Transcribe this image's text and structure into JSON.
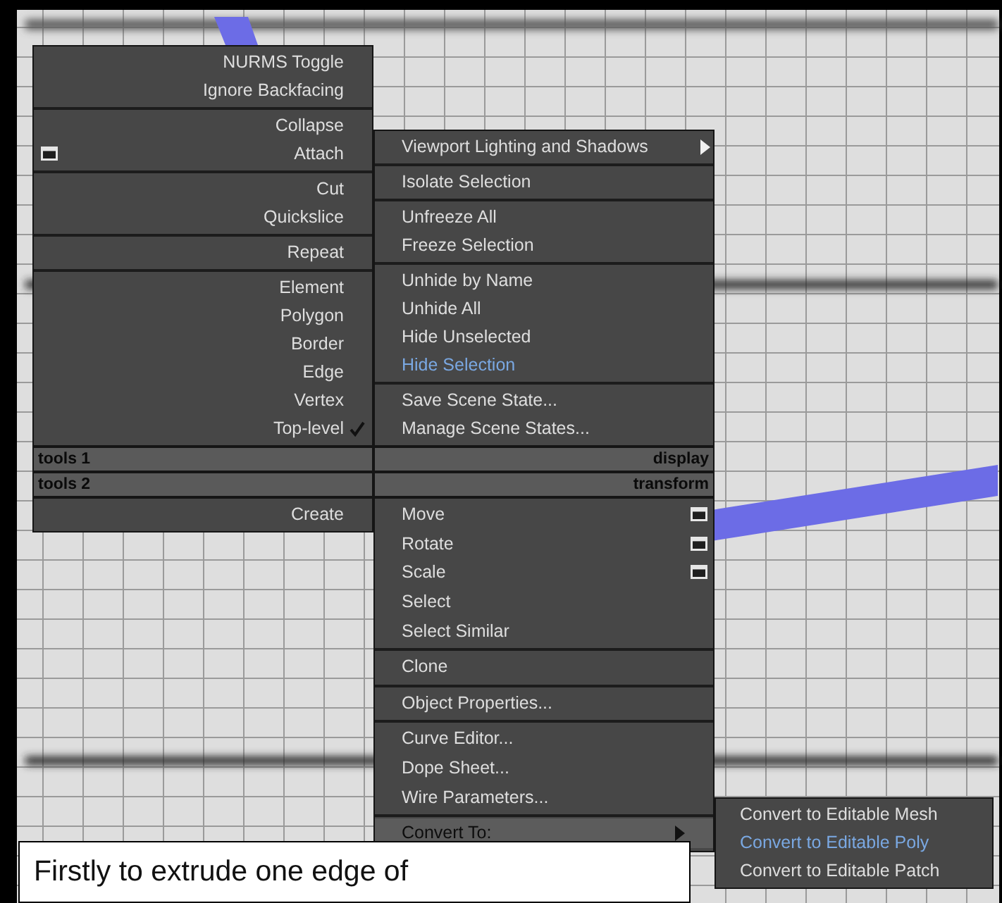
{
  "quad_menu": {
    "quads": [
      {
        "title": "tools 1",
        "groups": [
          {
            "items": [
              {
                "label": "NURMS Toggle",
                "kind": "plain",
                "checked": false,
                "disabled": false,
                "selected": false
              },
              {
                "label": "Ignore Backfacing",
                "kind": "plain",
                "checked": false,
                "disabled": false,
                "selected": false
              }
            ]
          },
          {
            "items": [
              {
                "label": "Collapse",
                "kind": "plain",
                "checked": false,
                "disabled": false,
                "selected": false
              },
              {
                "label": "Attach",
                "kind": "options",
                "checked": false,
                "disabled": false,
                "selected": false
              }
            ]
          },
          {
            "items": [
              {
                "label": "Cut",
                "kind": "plain",
                "checked": false,
                "disabled": false,
                "selected": false
              },
              {
                "label": "Quickslice",
                "kind": "plain",
                "checked": false,
                "disabled": false,
                "selected": false
              }
            ]
          },
          {
            "items": [
              {
                "label": "Repeat",
                "kind": "plain",
                "checked": false,
                "disabled": false,
                "selected": false
              }
            ]
          },
          {
            "items": [
              {
                "label": "Element",
                "kind": "plain",
                "checked": false,
                "disabled": false,
                "selected": false
              },
              {
                "label": "Polygon",
                "kind": "plain",
                "checked": false,
                "disabled": false,
                "selected": false
              },
              {
                "label": "Border",
                "kind": "plain",
                "checked": false,
                "disabled": false,
                "selected": false
              },
              {
                "label": "Edge",
                "kind": "plain",
                "checked": false,
                "disabled": false,
                "selected": false
              },
              {
                "label": "Vertex",
                "kind": "plain",
                "checked": false,
                "disabled": false,
                "selected": false
              },
              {
                "label": "Top-level",
                "kind": "plain",
                "checked": true,
                "disabled": false,
                "selected": false
              }
            ]
          }
        ]
      },
      {
        "title": "display",
        "groups": [
          {
            "items": [
              {
                "label": "Viewport Lighting and Shadows",
                "kind": "submenu",
                "checked": false,
                "disabled": false,
                "selected": false
              }
            ]
          },
          {
            "items": [
              {
                "label": "Isolate Selection",
                "kind": "plain",
                "checked": false,
                "disabled": false,
                "selected": false
              }
            ]
          },
          {
            "items": [
              {
                "label": "Unfreeze All",
                "kind": "plain",
                "checked": false,
                "disabled": false,
                "selected": false
              },
              {
                "label": "Freeze Selection",
                "kind": "plain",
                "checked": false,
                "disabled": false,
                "selected": false
              }
            ]
          },
          {
            "items": [
              {
                "label": "Unhide by Name",
                "kind": "plain",
                "checked": false,
                "disabled": false,
                "selected": false
              },
              {
                "label": "Unhide All",
                "kind": "plain",
                "checked": false,
                "disabled": false,
                "selected": false
              },
              {
                "label": "Hide Unselected",
                "kind": "plain",
                "checked": false,
                "disabled": false,
                "selected": false
              },
              {
                "label": "Hide Selection",
                "kind": "plain",
                "checked": false,
                "disabled": true,
                "selected": false
              }
            ]
          },
          {
            "items": [
              {
                "label": "Save Scene State...",
                "kind": "plain",
                "checked": false,
                "disabled": false,
                "selected": false
              },
              {
                "label": "Manage Scene States...",
                "kind": "plain",
                "checked": false,
                "disabled": false,
                "selected": false
              }
            ]
          }
        ]
      },
      {
        "title": "tools 2",
        "groups": [
          {
            "items": [
              {
                "label": "Create",
                "kind": "plain",
                "checked": false,
                "disabled": false,
                "selected": false
              }
            ]
          }
        ]
      },
      {
        "title": "transform",
        "groups": [
          {
            "items": [
              {
                "label": "Move",
                "kind": "options",
                "checked": false,
                "disabled": false,
                "selected": false
              },
              {
                "label": "Rotate",
                "kind": "options",
                "checked": false,
                "disabled": false,
                "selected": false
              },
              {
                "label": "Scale",
                "kind": "options",
                "checked": false,
                "disabled": false,
                "selected": false
              },
              {
                "label": "Select",
                "kind": "plain",
                "checked": false,
                "disabled": false,
                "selected": false
              },
              {
                "label": "Select Similar",
                "kind": "plain",
                "checked": false,
                "disabled": false,
                "selected": false
              }
            ]
          },
          {
            "items": [
              {
                "label": "Clone",
                "kind": "plain",
                "checked": false,
                "disabled": false,
                "selected": false
              }
            ]
          },
          {
            "items": [
              {
                "label": "Object Properties...",
                "kind": "plain",
                "checked": false,
                "disabled": false,
                "selected": false
              }
            ]
          },
          {
            "items": [
              {
                "label": "Curve Editor...",
                "kind": "plain",
                "checked": false,
                "disabled": false,
                "selected": false
              },
              {
                "label": "Dope Sheet...",
                "kind": "plain",
                "checked": false,
                "disabled": false,
                "selected": false
              },
              {
                "label": "Wire Parameters...",
                "kind": "plain",
                "checked": false,
                "disabled": false,
                "selected": false
              }
            ]
          },
          {
            "items": [
              {
                "label": "Convert To:",
                "kind": "submenu",
                "checked": false,
                "disabled": false,
                "selected": true
              }
            ]
          }
        ]
      }
    ]
  },
  "submenu": {
    "items": [
      {
        "label": "Convert to Editable Mesh",
        "disabled": false
      },
      {
        "label": "Convert to Editable Poly",
        "disabled": true
      },
      {
        "label": "Convert to Editable Patch",
        "disabled": false
      }
    ]
  },
  "caption": "Firstly to extrude one edge of"
}
